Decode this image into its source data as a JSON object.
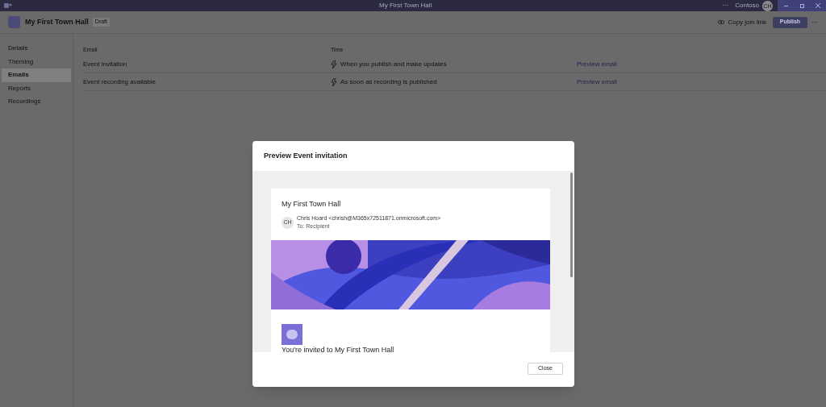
{
  "titlebar": {
    "title": "My First Town Hall",
    "more": "···",
    "org": "Contoso",
    "avatar": "CH"
  },
  "header": {
    "title": "My First Town Hall",
    "badge": "Draft",
    "copy_link": "Copy join link",
    "publish": "Publish",
    "more": "···"
  },
  "sidebar": {
    "items": [
      {
        "label": "Details",
        "selected": false
      },
      {
        "label": "Theming",
        "selected": false
      },
      {
        "label": "Emails",
        "selected": true
      },
      {
        "label": "Reports",
        "selected": false
      },
      {
        "label": "Recordings",
        "selected": false
      }
    ]
  },
  "table": {
    "columns": [
      "Email",
      "Time"
    ],
    "rows": [
      {
        "email": "Event invitation",
        "time": "When you publish and make updates",
        "action": "Preview email"
      },
      {
        "email": "Event recording available",
        "time": "As soon as recording is published",
        "action": "Preview email"
      }
    ]
  },
  "dialog": {
    "title": "Preview Event invitation",
    "email": {
      "subject": "My First Town Hall",
      "avatar": "CH",
      "sender": "Chris Hoard",
      "address": "<chrish@M365x72511871.onmicrosoft.com>",
      "to": "To: Recipient",
      "heading": "You're invited to My First Town Hall"
    },
    "close": "Close"
  }
}
